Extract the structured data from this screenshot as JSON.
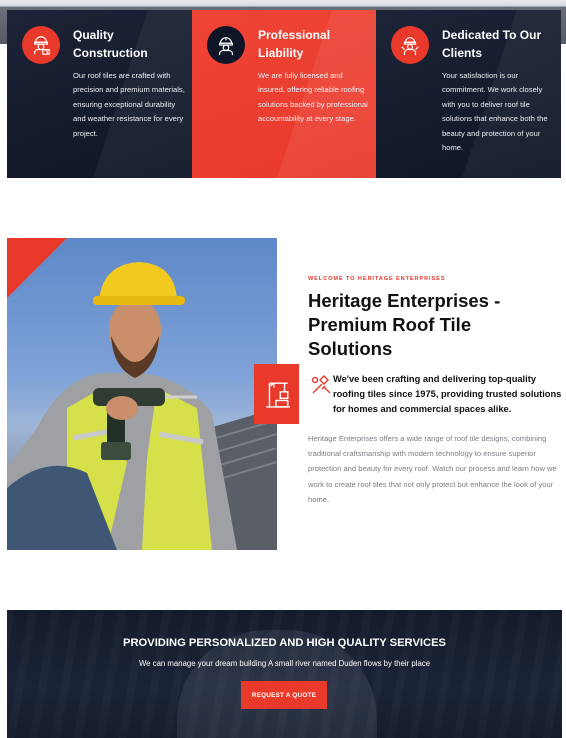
{
  "features": [
    {
      "icon": "construction-worker-blueprint-icon",
      "title": "Quality Construction",
      "text": "Our roof tiles are crafted with precision and premium materials, ensuring exceptional durability and weather resistance for every project."
    },
    {
      "icon": "worker-helmet-icon",
      "title": "Professional Liability",
      "text": "We are fully licensed and insured, offering reliable roofing solutions backed by professional accountability at every stage."
    },
    {
      "icon": "worker-tools-icon",
      "title": "Dedicated To Our Clients",
      "text": "Your satisfaction is our commitment. We work closely with you to deliver roof tile solutions that enhance both the beauty and protection of your home."
    }
  ],
  "about": {
    "eyebrow": "WELCOME TO HERITAGE ENTERPRISES",
    "heading": "Heritage Enterprises - Premium Roof Tile Solutions",
    "lead": "We've been crafting and delivering top-quality roofing tiles since 1975, providing trusted solutions for homes and commercial spaces alike.",
    "body": "Heritage Enterprises offers a wide range of roof tile designs, combining traditional craftsmanship with modern technology to ensure superior protection and beauty for every roof. Watch our process and learn how we work to create roof tiles that not only protect but enhance the look of your home.",
    "photo_icon": "roofer-with-drill-photo",
    "badge_icon": "crane-building-icon",
    "lead_icon": "hammer-tools-icon"
  },
  "cta": {
    "title": "PROVIDING PERSONALIZED AND HIGH QUALITY SERVICES",
    "subtitle": "We can manage your dream building A small river named Duden flows by their place",
    "button": "REQUEST A QUOTE"
  },
  "colors": {
    "accent": "#e8392b",
    "dark": "#0f1526"
  }
}
